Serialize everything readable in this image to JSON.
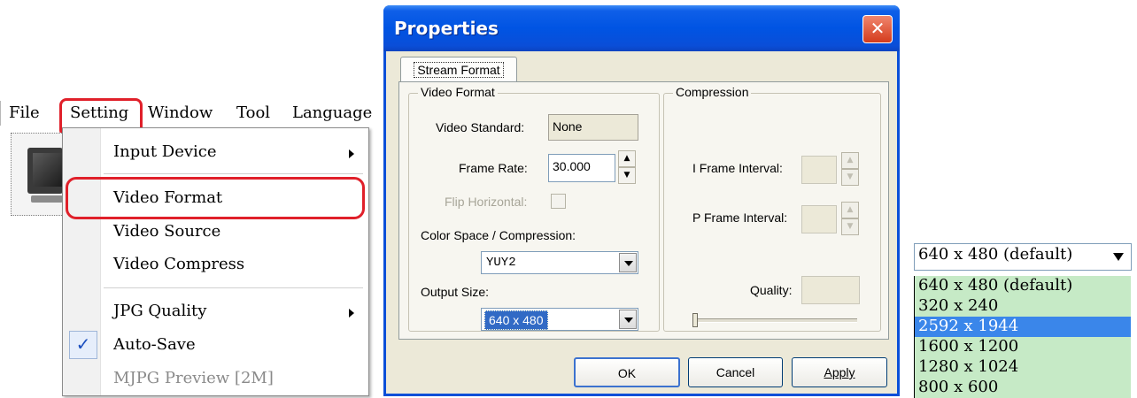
{
  "menubar": {
    "items": [
      "File",
      "Setting",
      "Window",
      "Tool",
      "Language"
    ]
  },
  "setting_menu": {
    "items": [
      {
        "label": "Input Device",
        "submenu": true
      },
      {
        "label": "Video Format",
        "highlighted": true
      },
      {
        "label": "Video Source"
      },
      {
        "label": "Video Compress"
      },
      {
        "label": "JPG Quality",
        "submenu": true
      },
      {
        "label": "Auto-Save",
        "checked": true
      },
      {
        "label": "MJPG Preview [2M]",
        "disabled": true
      }
    ],
    "check_glyph": "✓"
  },
  "dialog": {
    "title": "Properties",
    "close_glyph": "✕",
    "tab_label": "Stream Format",
    "video_format": {
      "group_label": "Video Format",
      "video_standard_label": "Video Standard:",
      "video_standard_value": "None",
      "frame_rate_label": "Frame Rate:",
      "frame_rate_value": "30.000",
      "flip_horizontal_label": "Flip Horizontal:",
      "color_space_label": "Color Space / Compression:",
      "color_space_value": "YUY2",
      "output_size_label": "Output Size:",
      "output_size_value": "640 x 480"
    },
    "compression": {
      "group_label": "Compression",
      "i_frame_label": "I Frame Interval:",
      "p_frame_label": "P Frame Interval:",
      "quality_label": "Quality:"
    },
    "buttons": {
      "ok": "OK",
      "cancel": "Cancel",
      "apply": "Apply"
    }
  },
  "resolution_dropdown": {
    "selected": "640 x 480  (default)",
    "options": [
      "640 x 480  (default)",
      "320 x 240",
      "2592 x 1944",
      "1600 x 1200",
      "1280 x 1024",
      "800 x 600"
    ],
    "highlighted_option": "2592 x 1944"
  },
  "colors": {
    "highlight_outline": "#e0202a",
    "title_bar": "#0054e3",
    "list_background": "#c6eac6",
    "list_selection": "#3a86ea"
  }
}
